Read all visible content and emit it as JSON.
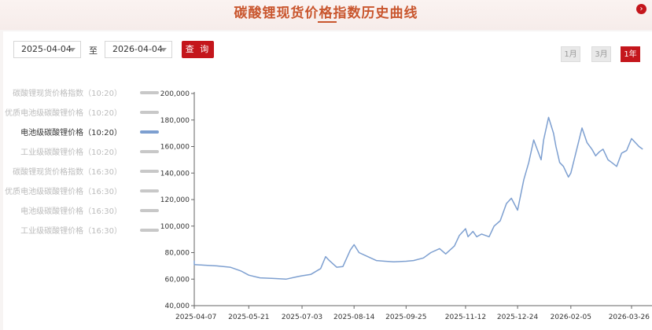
{
  "page": {
    "title": "碳酸锂现货价格指数历史曲线",
    "corner_icon": "chevron-right-icon"
  },
  "controls": {
    "start_date": "2025-04-04",
    "separator": "至",
    "end_date": "2026-04-04",
    "query_label": "查 询",
    "ranges": [
      {
        "label": "1月",
        "active": false
      },
      {
        "label": "3月",
        "active": false
      },
      {
        "label": "1年",
        "active": true
      }
    ]
  },
  "legend": [
    {
      "label": "碳酸锂现货价格指数（10:20）",
      "active": false
    },
    {
      "label": "优质电池级碳酸锂价格（10:20）",
      "active": false
    },
    {
      "label": "电池级碳酸锂价格（10:20）",
      "active": true
    },
    {
      "label": "工业级碳酸锂价格（10:20）",
      "active": false
    },
    {
      "label": "碳酸锂现货价格指数（16:30）",
      "active": false
    },
    {
      "label": "优质电池级碳酸锂价格（16:30）",
      "active": false
    },
    {
      "label": "电池级碳酸锂价格（16:30）",
      "active": false
    },
    {
      "label": "工业级碳酸锂价格（16:30）",
      "active": false
    }
  ],
  "colors": {
    "line": "#7d9fd0",
    "accent": "#c4161c",
    "title": "#c9562e"
  },
  "chart_data": {
    "type": "line",
    "x_ticks": [
      "2025-04-07",
      "2025-05-21",
      "2025-07-03",
      "2025-08-14",
      "2025-09-25",
      "2025-11-12",
      "2025-12-24",
      "2026-02-05",
      "2026-03-26"
    ],
    "y_ticks": [
      "40,000",
      "60,000",
      "80,000",
      "100,000",
      "120,000",
      "140,000",
      "160,000",
      "180,000",
      "200,000"
    ],
    "ylim": [
      40000,
      200000
    ],
    "grid": false,
    "series": [
      {
        "name": "电池级碳酸锂价格（10:20）",
        "x": [
          "2025-04-04",
          "2025-04-07",
          "2025-04-15",
          "2025-04-25",
          "2025-05-06",
          "2025-05-15",
          "2025-05-21",
          "2025-05-30",
          "2025-06-10",
          "2025-06-20",
          "2025-06-30",
          "2025-07-03",
          "2025-07-10",
          "2025-07-18",
          "2025-07-22",
          "2025-07-25",
          "2025-07-31",
          "2025-08-05",
          "2025-08-11",
          "2025-08-14",
          "2025-08-18",
          "2025-08-25",
          "2025-09-01",
          "2025-09-08",
          "2025-09-15",
          "2025-09-25",
          "2025-10-01",
          "2025-10-09",
          "2025-10-15",
          "2025-10-22",
          "2025-10-27",
          "2025-11-03",
          "2025-11-07",
          "2025-11-12",
          "2025-11-14",
          "2025-11-18",
          "2025-11-21",
          "2025-11-25",
          "2025-12-01",
          "2025-12-05",
          "2025-12-10",
          "2025-12-15",
          "2025-12-19",
          "2025-12-24",
          "2025-12-29",
          "2026-01-02",
          "2026-01-06",
          "2026-01-08",
          "2026-01-12",
          "2026-01-14",
          "2026-01-18",
          "2026-01-22",
          "2026-01-24",
          "2026-01-27",
          "2026-01-30",
          "2026-02-03",
          "2026-02-05",
          "2026-02-09",
          "2026-02-14",
          "2026-02-18",
          "2026-02-22",
          "2026-02-25",
          "2026-02-28",
          "2026-03-03",
          "2026-03-07",
          "2026-03-10",
          "2026-03-14",
          "2026-03-18",
          "2026-03-22",
          "2026-03-26",
          "2026-03-29",
          "2026-04-01",
          "2026-04-04"
        ],
        "y": [
          74000,
          71000,
          70500,
          70000,
          69000,
          66000,
          63000,
          61000,
          60500,
          60000,
          62000,
          62500,
          63500,
          68000,
          77000,
          74000,
          69000,
          69500,
          82000,
          86000,
          80000,
          77000,
          74000,
          73500,
          73000,
          73500,
          74000,
          76000,
          80000,
          83000,
          79000,
          85000,
          93000,
          98000,
          92000,
          96000,
          92000,
          94000,
          92000,
          100000,
          104000,
          117000,
          121000,
          112000,
          135000,
          148000,
          165000,
          160000,
          150000,
          165000,
          182000,
          170000,
          160000,
          148000,
          145000,
          137000,
          140000,
          155000,
          174000,
          163000,
          158000,
          153000,
          156000,
          158000,
          150000,
          148000,
          145000,
          155000,
          157000,
          166000,
          163000,
          160000,
          158000
        ]
      }
    ]
  }
}
